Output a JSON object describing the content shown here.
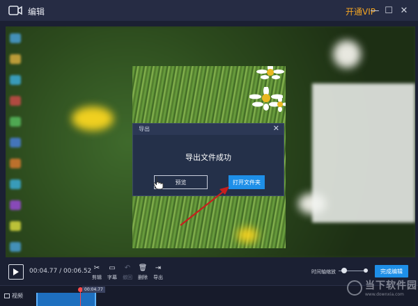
{
  "titlebar": {
    "title": "编辑",
    "vip": "开通VIP",
    "minimize": "—",
    "maximize": "☐",
    "close": "✕"
  },
  "dialog": {
    "title": "导出",
    "close": "✕",
    "message": "导出文件成功",
    "preview_label": "预览",
    "open_folder_label": "打开文件夹"
  },
  "toolbar": {
    "current_time": "00:04.77",
    "separator": " / ",
    "total_time": "00:06.52",
    "tools": [
      {
        "icon": "scissors-icon",
        "glyph": "✂",
        "label": "剪辑",
        "enabled": true
      },
      {
        "icon": "subtitle-icon",
        "glyph": "▭",
        "label": "字幕",
        "enabled": true
      },
      {
        "icon": "undo-icon",
        "glyph": "↶",
        "label": "撤回",
        "enabled": false
      },
      {
        "icon": "trash-icon",
        "glyph": "🗑",
        "label": "删除",
        "enabled": true
      },
      {
        "icon": "export-icon",
        "glyph": "⇥",
        "label": "导出",
        "enabled": true
      }
    ],
    "zoom_label": "时间轴缩放",
    "finish_label": "完成编辑"
  },
  "timeline": {
    "track_label": "视频",
    "playhead_time": "00:04.77"
  },
  "watermark": {
    "main": "当下软件园",
    "sub": "www.downxia.com"
  },
  "colors": {
    "accent": "#1e8fe8",
    "vip": "#f5a623",
    "playhead": "#ff4a4a"
  }
}
